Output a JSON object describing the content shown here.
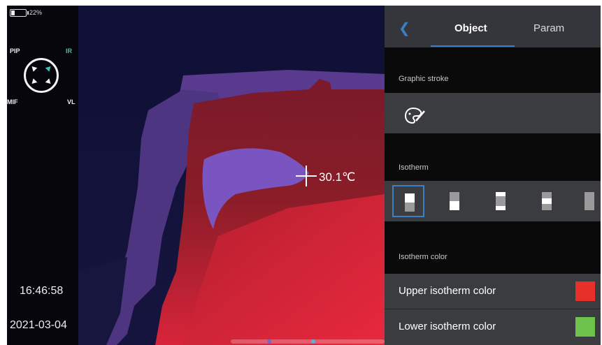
{
  "status": {
    "battery": "22%"
  },
  "modes": {
    "pip": "PIP",
    "ir": "IR",
    "mif": "MIF",
    "vl": "VL"
  },
  "clock": {
    "time": "16:46:58",
    "date": "2021-03-04"
  },
  "thermal": {
    "spot_temp": "30.1℃"
  },
  "panel": {
    "back_icon": "chevron-left-icon",
    "tabs": [
      {
        "label": "Object",
        "active": true
      },
      {
        "label": "Param",
        "active": false
      }
    ],
    "graphic_stroke_title": "Graphic stroke",
    "graphic_stroke_icon": "palette-pen-icon",
    "isotherm_title": "Isotherm",
    "isotherm_options": [
      {
        "name": "isotherm-upper",
        "selected": true
      },
      {
        "name": "isotherm-lower",
        "selected": false
      },
      {
        "name": "isotherm-interval",
        "selected": false
      },
      {
        "name": "isotherm-band",
        "selected": false
      },
      {
        "name": "isotherm-off",
        "selected": false
      }
    ],
    "isotherm_color_title": "Isotherm color",
    "upper_label": "Upper isotherm color",
    "upper_color": "#e8302b",
    "lower_label": "Lower isotherm color",
    "lower_color": "#6cc24a"
  }
}
